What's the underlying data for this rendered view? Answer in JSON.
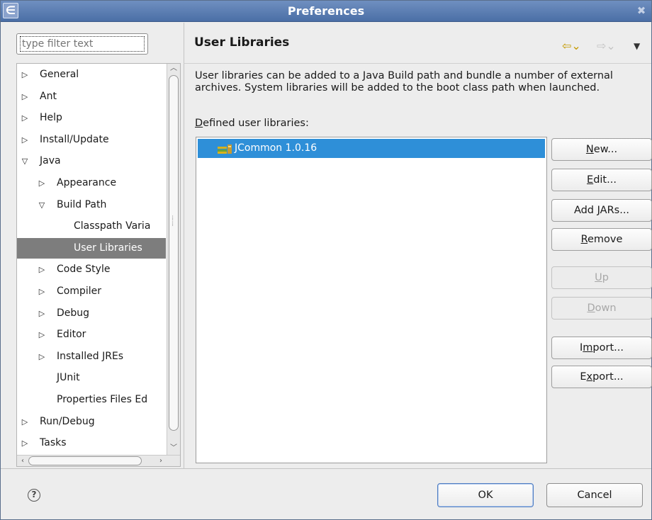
{
  "window": {
    "title": "Preferences",
    "app_icon": "eclipse-icon",
    "close_glyph": "✖"
  },
  "filter": {
    "placeholder": "type filter text",
    "value": "type filter text"
  },
  "tree": {
    "items": [
      {
        "label": "General",
        "expanded": false,
        "has_children": true,
        "level": 0
      },
      {
        "label": "Ant",
        "expanded": false,
        "has_children": true,
        "level": 0
      },
      {
        "label": "Help",
        "expanded": false,
        "has_children": true,
        "level": 0
      },
      {
        "label": "Install/Update",
        "expanded": false,
        "has_children": true,
        "level": 0
      },
      {
        "label": "Java",
        "expanded": true,
        "has_children": true,
        "level": 0
      },
      {
        "label": "Appearance",
        "expanded": false,
        "has_children": true,
        "level": 1
      },
      {
        "label": "Build Path",
        "expanded": true,
        "has_children": true,
        "level": 1
      },
      {
        "label": "Classpath Varia",
        "has_children": false,
        "level": 2
      },
      {
        "label": "User Libraries",
        "has_children": false,
        "level": 2,
        "selected": true
      },
      {
        "label": "Code Style",
        "expanded": false,
        "has_children": true,
        "level": 1
      },
      {
        "label": "Compiler",
        "expanded": false,
        "has_children": true,
        "level": 1
      },
      {
        "label": "Debug",
        "expanded": false,
        "has_children": true,
        "level": 1
      },
      {
        "label": "Editor",
        "expanded": false,
        "has_children": true,
        "level": 1
      },
      {
        "label": "Installed JREs",
        "expanded": false,
        "has_children": true,
        "level": 1
      },
      {
        "label": "JUnit",
        "has_children": false,
        "level": 1
      },
      {
        "label": "Properties Files Ed",
        "has_children": false,
        "level": 1
      },
      {
        "label": "Run/Debug",
        "expanded": false,
        "has_children": true,
        "level": 0
      },
      {
        "label": "Tasks",
        "expanded": false,
        "has_children": true,
        "level": 0
      }
    ]
  },
  "page": {
    "title": "User Libraries",
    "description": "User libraries can be added to a Java Build path and bundle a number of external archives. System libraries will be added to the boot class path when launched.",
    "defined_label_mnemonic": "D",
    "defined_label_rest": "efined user libraries:",
    "libraries": [
      {
        "label": "JCommon 1.0.16",
        "icon": "library-icon",
        "selected": true
      }
    ],
    "nav_back": "⇦⌄",
    "nav_forward": "⇨⌄",
    "nav_menu": "▼"
  },
  "buttons": {
    "new": {
      "pre": "",
      "mn": "N",
      "post": "ew...",
      "enabled": true
    },
    "edit": {
      "pre": "",
      "mn": "E",
      "post": "dit...",
      "enabled": true
    },
    "add_jars": {
      "pre": "Add ",
      "mn": "J",
      "post": "ARs...",
      "enabled": true
    },
    "remove": {
      "pre": "",
      "mn": "R",
      "post": "emove",
      "enabled": true
    },
    "up": {
      "pre": "",
      "mn": "U",
      "post": "p",
      "enabled": false
    },
    "down": {
      "pre": "",
      "mn": "D",
      "post": "own",
      "enabled": false
    },
    "import": {
      "pre": "I",
      "mn": "m",
      "post": "port...",
      "enabled": true
    },
    "export": {
      "pre": "E",
      "mn": "x",
      "post": "port...",
      "enabled": true
    }
  },
  "footer": {
    "help_glyph": "?",
    "ok_label": "OK",
    "cancel_label": "Cancel"
  }
}
